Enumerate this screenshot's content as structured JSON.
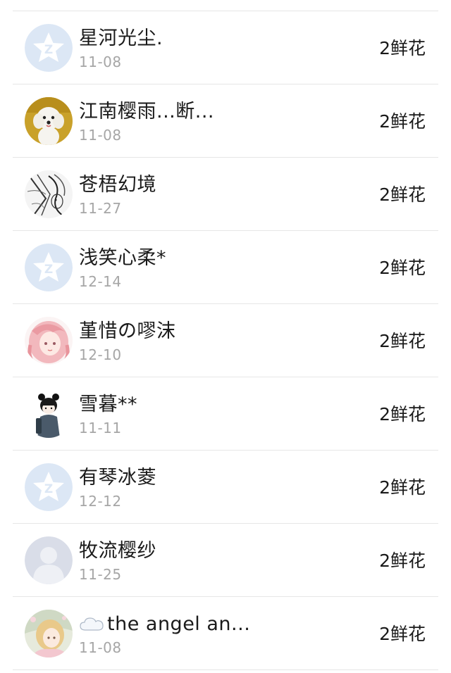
{
  "rows": [
    {
      "name": "星河光尘.",
      "date": "11-08",
      "gift": "2鲜花",
      "avatar": "qzone-star-icon"
    },
    {
      "name": "江南樱雨...断...",
      "date": "11-08",
      "gift": "2鲜花",
      "avatar": "dog-photo-avatar"
    },
    {
      "name": "苍梧幻境",
      "date": "11-27",
      "gift": "2鲜花",
      "avatar": "sketch-portrait-avatar"
    },
    {
      "name": "浅笑心柔*",
      "date": "12-14",
      "gift": "2鲜花",
      "avatar": "qzone-star-icon"
    },
    {
      "name": "堇惜の嘐沫",
      "date": "12-10",
      "gift": "2鲜花",
      "avatar": "pink-hair-girl-avatar"
    },
    {
      "name": "雪暮**",
      "date": "11-11",
      "gift": "2鲜花",
      "avatar": "cartoon-girl-avatar"
    },
    {
      "name": "有琴冰菱",
      "date": "12-12",
      "gift": "2鲜花",
      "avatar": "qzone-star-icon"
    },
    {
      "name": "牧流樱纱",
      "date": "11-25",
      "gift": "2鲜花",
      "avatar": "default-person-icon"
    },
    {
      "name": "the angel an...",
      "date": "11-08",
      "gift": "2鲜花",
      "avatar": "anime-girl-avatar",
      "name_prefix_icon": "cloud-icon"
    }
  ]
}
